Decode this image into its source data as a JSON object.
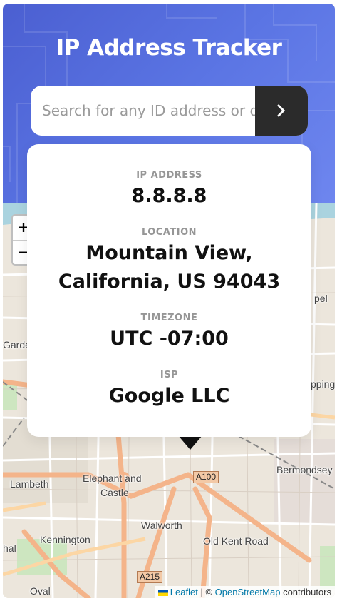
{
  "header": {
    "title": "IP Address Tracker",
    "search_placeholder": "Search for any ID address or domain",
    "submit_icon": "chevron-right-icon"
  },
  "info": {
    "ip_label": "IP ADDRESS",
    "ip_value": "8.8.8.8",
    "location_label": "LOCATION",
    "location_line1": "Mountain View,",
    "location_line2": "California, US 94043",
    "timezone_label": "TIMEZONE",
    "timezone_value": "UTC -07:00",
    "isp_label": "ISP",
    "isp_value": "Google LLC"
  },
  "map": {
    "zoom_in": "+",
    "zoom_out": "−",
    "labels": {
      "lambeth": "Lambeth",
      "elephant1": "Elephant and",
      "elephant2": "Castle",
      "kennington": "Kennington",
      "walworth": "Walworth",
      "oldkent": "Old Kent Road",
      "bermondsey": "Bermondsey",
      "oval": "Oval",
      "garde": "Garde",
      "pel": "pel",
      "pping": "pping",
      "hal": "hal"
    },
    "roads": {
      "a100": "A100",
      "a215": "A215"
    },
    "attribution": {
      "leaflet": "Leaflet",
      "separator": "| ©",
      "osm": "OpenStreetMap",
      "contributors": "contributors"
    }
  },
  "colors": {
    "header_gradient_start": "#4b5fd1",
    "header_gradient_end": "#6e86ef",
    "button_bg": "#2b2b2b",
    "label_gray": "#969696",
    "value_dark": "#111111"
  }
}
